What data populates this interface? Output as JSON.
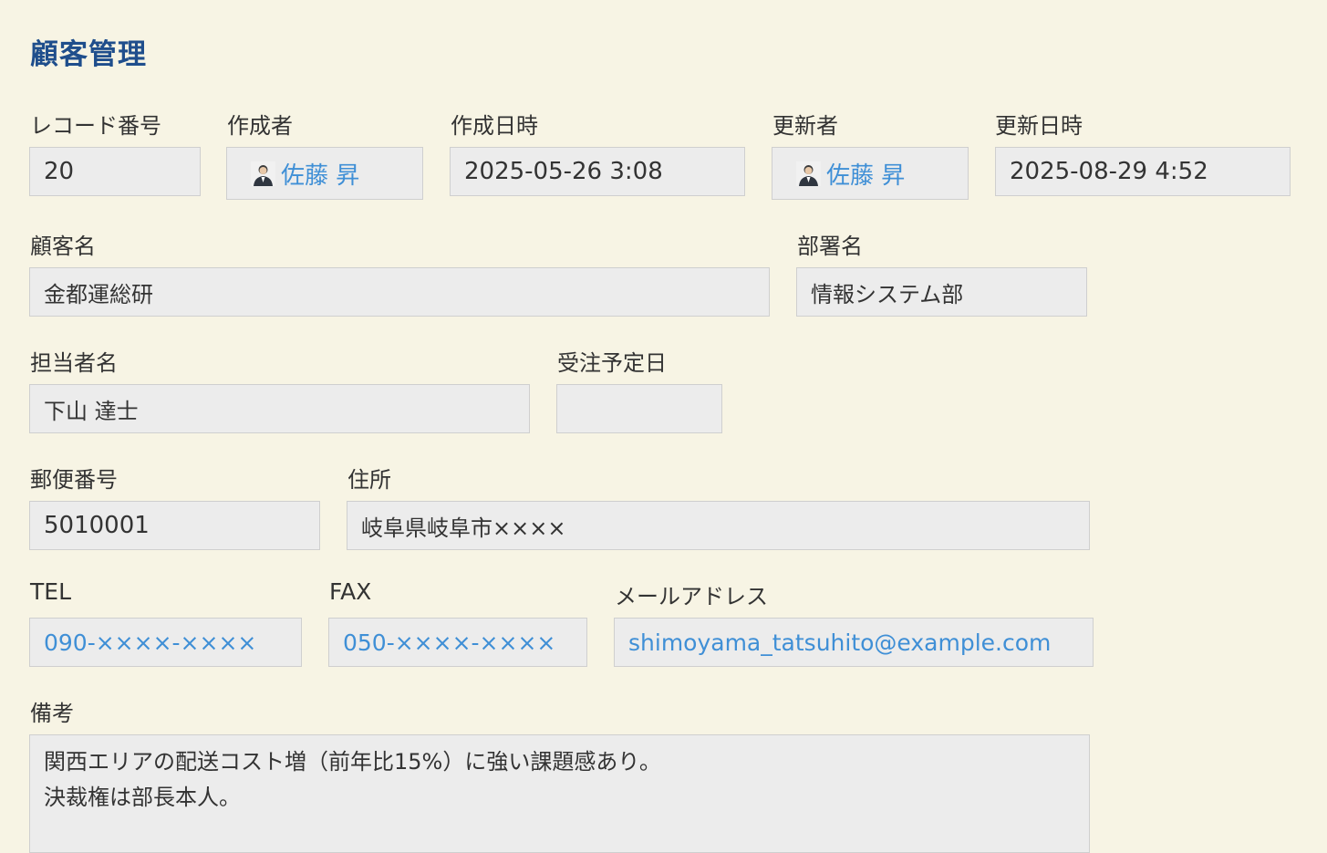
{
  "page": {
    "title": "顧客管理"
  },
  "record": {
    "record_no": {
      "label": "レコード番号",
      "value": "20"
    },
    "creator": {
      "label": "作成者",
      "value": "佐藤 昇",
      "icon": "user-avatar-icon"
    },
    "created_at": {
      "label": "作成日時",
      "value": "2025-05-26 3:08"
    },
    "updater": {
      "label": "更新者",
      "value": "佐藤 昇",
      "icon": "user-avatar-icon"
    },
    "updated_at": {
      "label": "更新日時",
      "value": "2025-08-29 4:52"
    }
  },
  "customer": {
    "name": {
      "label": "顧客名",
      "value": "金都運総研"
    },
    "department": {
      "label": "部署名",
      "value": "情報システム部"
    },
    "contact": {
      "label": "担当者名",
      "value": "下山 達士"
    },
    "order_date": {
      "label": "受注予定日",
      "value": ""
    },
    "postal": {
      "label": "郵便番号",
      "value": "5010001"
    },
    "address": {
      "label": "住所",
      "value": "岐阜県岐阜市××××"
    },
    "tel": {
      "label": "TEL",
      "value": "090-××××-××××"
    },
    "fax": {
      "label": "FAX",
      "value": "050-××××-××××"
    },
    "email": {
      "label": "メールアドレス",
      "value": "shimoyama_tatsuhito@example.com"
    },
    "memo": {
      "label": "備考",
      "lines": [
        "関西エリアの配送コスト増（前年比15%）に強い課題感あり。",
        "決裁権は部長本人。"
      ]
    }
  },
  "colors": {
    "background": "#f7f4e4",
    "title": "#1f4e8c",
    "link": "#3f8fd6",
    "field": "#ececec"
  }
}
